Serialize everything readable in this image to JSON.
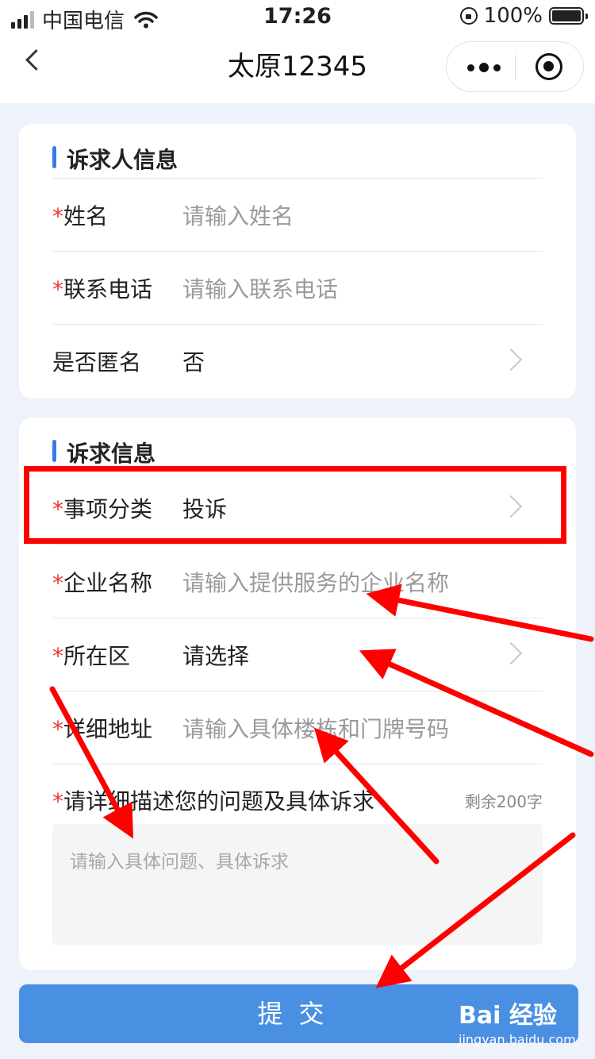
{
  "status_bar": {
    "carrier": "中国电信",
    "time": "17:26",
    "battery": "100%"
  },
  "nav": {
    "title": "太原12345"
  },
  "section1": {
    "title": "诉求人信息",
    "rows": [
      {
        "star": "*",
        "label": "姓名",
        "placeholder": "请输入姓名"
      },
      {
        "star": "*",
        "label": "联系电话",
        "placeholder": "请输入联系电话"
      },
      {
        "label": "是否匿名",
        "value": "否"
      }
    ]
  },
  "section2": {
    "title": "诉求信息",
    "rows": [
      {
        "star": "*",
        "label": "事项分类",
        "value": "投诉"
      },
      {
        "star": "*",
        "label": "企业名称",
        "placeholder": "请输入提供服务的企业名称"
      },
      {
        "star": "*",
        "label": "所在区",
        "value": "请选择"
      },
      {
        "star": "*",
        "label": "详细地址",
        "placeholder": "请输入具体楼栋和门牌号码"
      }
    ],
    "description": {
      "star": "*",
      "label": "请详细描述您的问题及具体诉求",
      "remaining": "剩余200字",
      "placeholder": "请输入具体问题、具体诉求"
    }
  },
  "submit": {
    "label": "提交"
  },
  "watermark": {
    "brand": "Bai 经验",
    "url": "jingyan.baidu.com"
  },
  "colors": {
    "accent": "#3b7be6",
    "button": "#4a90e2",
    "required": "#e63b3b",
    "annotation": "#ff0000"
  }
}
